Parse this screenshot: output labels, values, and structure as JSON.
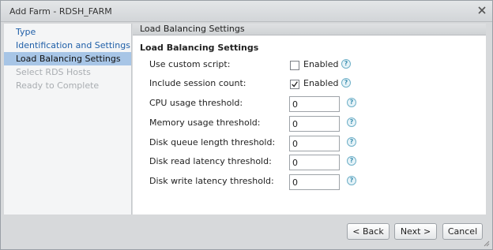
{
  "window": {
    "title": "Add Farm - RDSH_FARM",
    "close_icon": "close-icon"
  },
  "sidebar": {
    "items": [
      {
        "label": "Type",
        "state": "link"
      },
      {
        "label": "Identification and Settings",
        "state": "link"
      },
      {
        "label": "Load Balancing Settings",
        "state": "active"
      },
      {
        "label": "Select RDS Hosts",
        "state": "disabled"
      },
      {
        "label": "Ready to Complete",
        "state": "disabled"
      }
    ]
  },
  "panel": {
    "header": "Load Balancing Settings",
    "section_title": "Load Balancing Settings",
    "rows": [
      {
        "label": "Use custom script:",
        "type": "checkbox",
        "checked": false,
        "check_label": "Enabled"
      },
      {
        "label": "Include session count:",
        "type": "checkbox",
        "checked": true,
        "check_label": "Enabled"
      },
      {
        "label": "CPU usage threshold:",
        "type": "number",
        "value": "0"
      },
      {
        "label": "Memory usage threshold:",
        "type": "number",
        "value": "0"
      },
      {
        "label": "Disk queue length threshold:",
        "type": "number",
        "value": "0"
      },
      {
        "label": "Disk read latency threshold:",
        "type": "number",
        "value": "0"
      },
      {
        "label": "Disk write latency threshold:",
        "type": "number",
        "value": "0"
      }
    ],
    "help_glyph": "?"
  },
  "footer": {
    "back_label": "< Back",
    "next_label": "Next >",
    "cancel_label": "Cancel"
  },
  "colors": {
    "link": "#1f5fa8",
    "active_bg": "#a7c5e6",
    "disabled": "#a9adb1",
    "help": "#3b8fb0"
  }
}
